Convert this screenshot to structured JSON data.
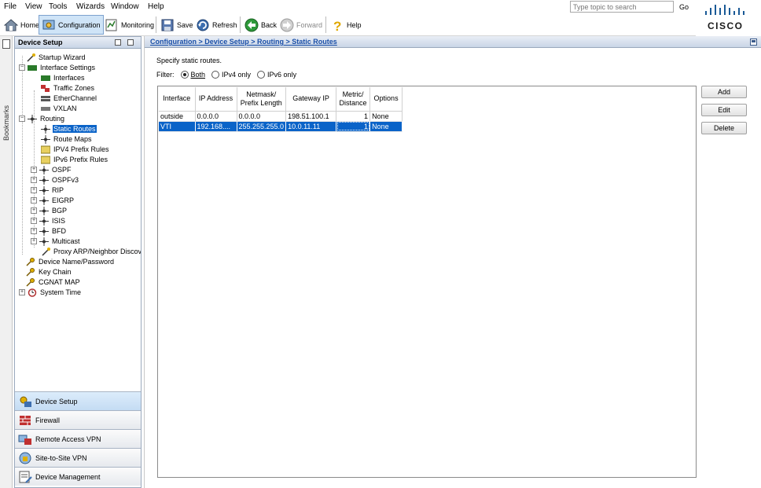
{
  "menu": {
    "items": [
      "File",
      "View",
      "Tools",
      "Wizards",
      "Window",
      "Help"
    ],
    "search_placeholder": "Type topic to search",
    "go_label": "Go"
  },
  "brand": {
    "logo_text": "CISCO"
  },
  "toolbar": {
    "home": "Home",
    "configuration": "Configuration",
    "monitoring": "Monitoring",
    "save": "Save",
    "refresh": "Refresh",
    "back": "Back",
    "forward": "Forward",
    "help": "Help"
  },
  "bookmarks_label": "Bookmarks",
  "left_panel": {
    "title": "Device Setup",
    "tree": [
      "Startup Wizard",
      "Interface Settings",
      "Interfaces",
      "Traffic Zones",
      "EtherChannel",
      "VXLAN",
      "Routing",
      "Static Routes",
      "Route Maps",
      "IPV4 Prefix Rules",
      "IPv6 Prefix Rules",
      "OSPF",
      "OSPFv3",
      "RIP",
      "EIGRP",
      "BGP",
      "ISIS",
      "BFD",
      "Multicast",
      "Proxy ARP/Neighbor Discove",
      "Device Name/Password",
      "Key Chain",
      "CGNAT MAP",
      "System Time"
    ],
    "nav": [
      "Device Setup",
      "Firewall",
      "Remote Access VPN",
      "Site-to-Site VPN",
      "Device Management"
    ]
  },
  "main": {
    "breadcrumb": "Configuration > Device Setup > Routing > Static Routes",
    "description": "Specify static routes.",
    "filter_label": "Filter:",
    "filter_options": [
      "Both",
      "IPv4 only",
      "IPv6 only"
    ],
    "table": {
      "headers": [
        "Interface",
        "IP Address",
        "Netmask/\nPrefix Length",
        "Gateway IP",
        "Metric/\nDistance",
        "Options"
      ],
      "rows": [
        [
          "outside",
          "0.0.0.0",
          "0.0.0.0",
          "198.51.100.1",
          "1",
          "None"
        ],
        [
          "VTI",
          "192.168....",
          "255.255.255.0",
          "10.0.11.11",
          "1",
          "None"
        ]
      ]
    },
    "buttons": {
      "add": "Add",
      "edit": "Edit",
      "delete": "Delete"
    }
  },
  "colors": {
    "selection": "#0a63c8",
    "link": "#1a4fa8",
    "panel_header": "#c9d5e6"
  }
}
